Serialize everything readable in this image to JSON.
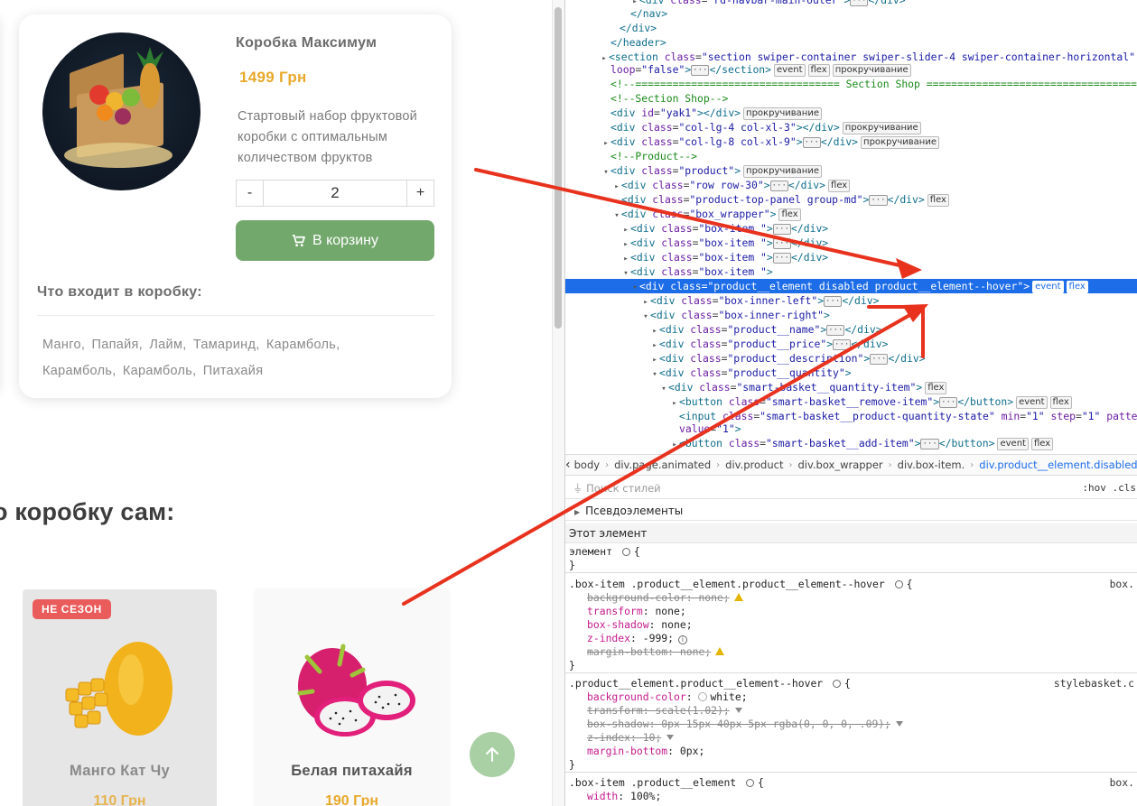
{
  "box_card": {
    "name": "Коробка Максимум",
    "price": "1499 Грн",
    "description": "Стартовый набор фруктовой коробки с оптимальным количеством фруктов",
    "qty_minus": "-",
    "qty_value": "2",
    "qty_plus": "+",
    "cart_label": "В корзину",
    "includes_title": "Что входит в коробку:",
    "fruits": [
      "Манго,",
      "Папайя,",
      "Лайм,",
      "Тамаринд,",
      "Карамболь,",
      "Карамболь,",
      "Карамболь,",
      "Питахайя"
    ]
  },
  "section_heading": "о коробку сам:",
  "fruit_cards": [
    {
      "badge": "НЕ СЕЗОН",
      "title": "Манго Кат Чу",
      "price": "110 Грн"
    },
    {
      "title": "Белая питахайя",
      "price": "190 Грн"
    }
  ],
  "devtools": {
    "breadcrumbs": [
      "body",
      "div.page.animated",
      "div.product",
      "div.box_wrapper",
      "div.box-item.",
      "div.product__element.disabled.product__ele"
    ],
    "filter_placeholder": "Поиск стилей",
    "filter_toggles": ":hov .cls",
    "pseudo_label": "Псевдоэлементы",
    "this_element_label": "Этот элемент"
  },
  "colors": {
    "accent_green": "#73a86d",
    "price_orange": "#e8a92b",
    "badge_red": "#ea5b5b",
    "selection_blue": "#1d6ce8",
    "annotation_red": "#e8321e"
  }
}
